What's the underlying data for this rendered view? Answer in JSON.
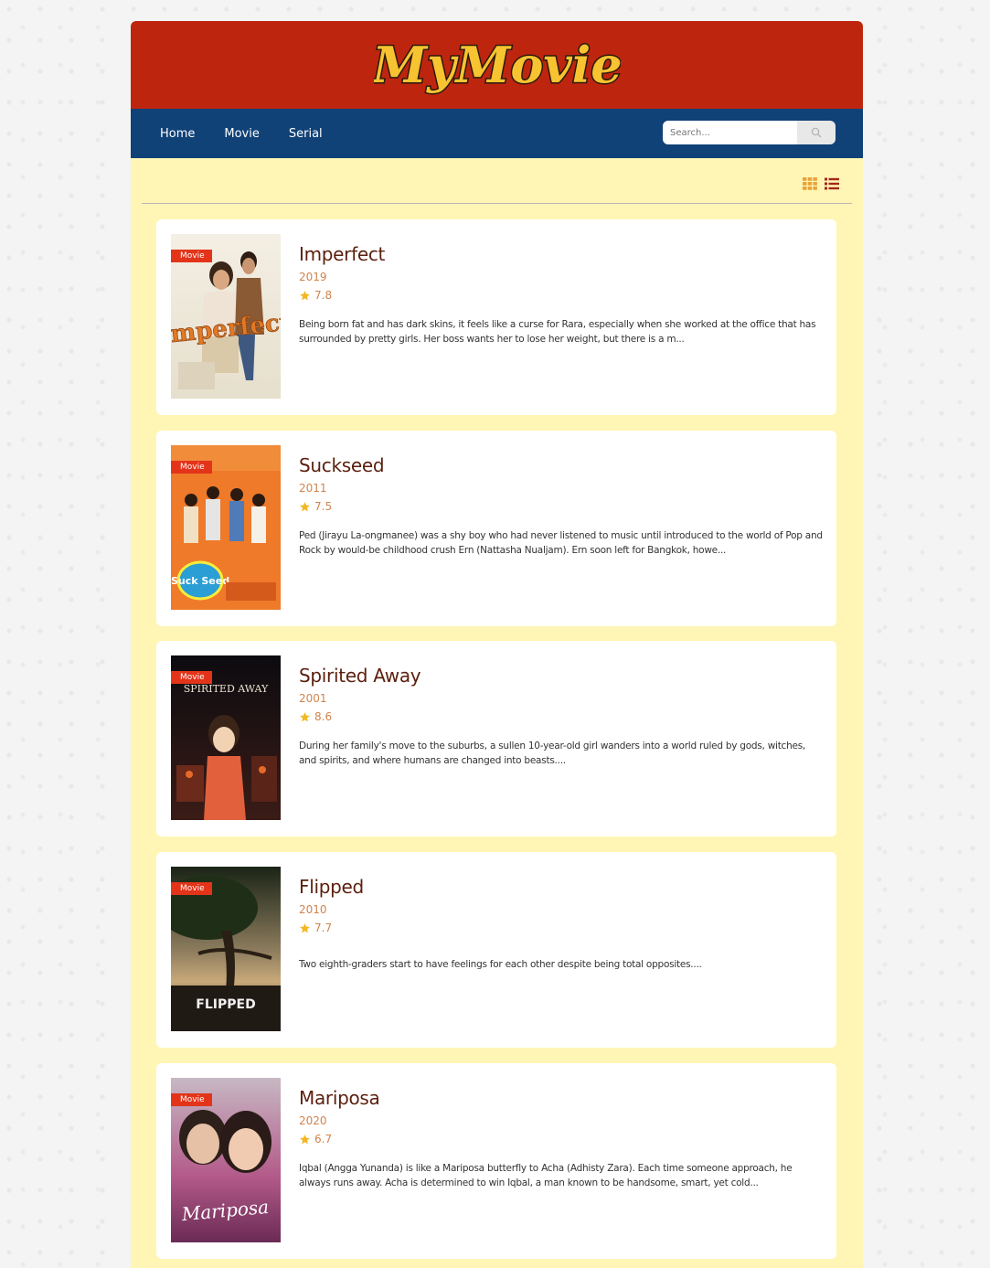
{
  "brand": {
    "logo_text": "MyMovie"
  },
  "nav": {
    "items": [
      {
        "label": "Home"
      },
      {
        "label": "Movie"
      },
      {
        "label": "Serial"
      }
    ]
  },
  "search": {
    "placeholder": "Search..."
  },
  "colors": {
    "header_red": "#be250f",
    "nav_blue": "#104177",
    "content_bg": "#fff6b5",
    "accent_orange": "#e8a33a",
    "badge_red": "#e3341a"
  },
  "icons": {
    "search": "magnifier-icon",
    "grid_view": "grid-icon",
    "list_view": "list-icon",
    "rating": "star-icon"
  },
  "movies": [
    {
      "badge": "Movie",
      "title": "Imperfect",
      "year": "2019",
      "rating": "7.8",
      "description": "Being born fat and has dark skins, it feels like a curse for Rara, especially when she worked at the office that has surrounded by pretty girls. Her boss wants her to lose her weight, but there is a m...",
      "poster_text": "Imperfect"
    },
    {
      "badge": "Movie",
      "title": "Suckseed",
      "year": "2011",
      "rating": "7.5",
      "description": "Ped (Jirayu La-ongmanee) was a shy boy who had never listened to music until introduced to the world of Pop and Rock by would-be childhood crush Ern (Nattasha Nualjam). Ern soon left for Bangkok, howe...",
      "poster_text": "Suck Seed"
    },
    {
      "badge": "Movie",
      "title": "Spirited Away",
      "year": "2001",
      "rating": "8.6",
      "description": "During her family's move to the suburbs, a sullen 10-year-old girl wanders into a world ruled by gods, witches, and spirits, and where humans are changed into beasts....",
      "poster_text": "SPIRITED AWAY"
    },
    {
      "badge": "Movie",
      "title": "Flipped",
      "year": "2010",
      "rating": "7.7",
      "description": "Two eighth-graders start to have feelings for each other despite being total opposites....",
      "poster_text": "FLIPPED"
    },
    {
      "badge": "Movie",
      "title": "Mariposa",
      "year": "2020",
      "rating": "6.7",
      "description": "Iqbal (Angga Yunanda) is like a Mariposa butterfly to Acha (Adhisty Zara). Each time someone approach, he always runs away. Acha is determined to win Iqbal, a man known to be handsome, smart, yet cold...",
      "poster_text": "Mariposa"
    }
  ]
}
